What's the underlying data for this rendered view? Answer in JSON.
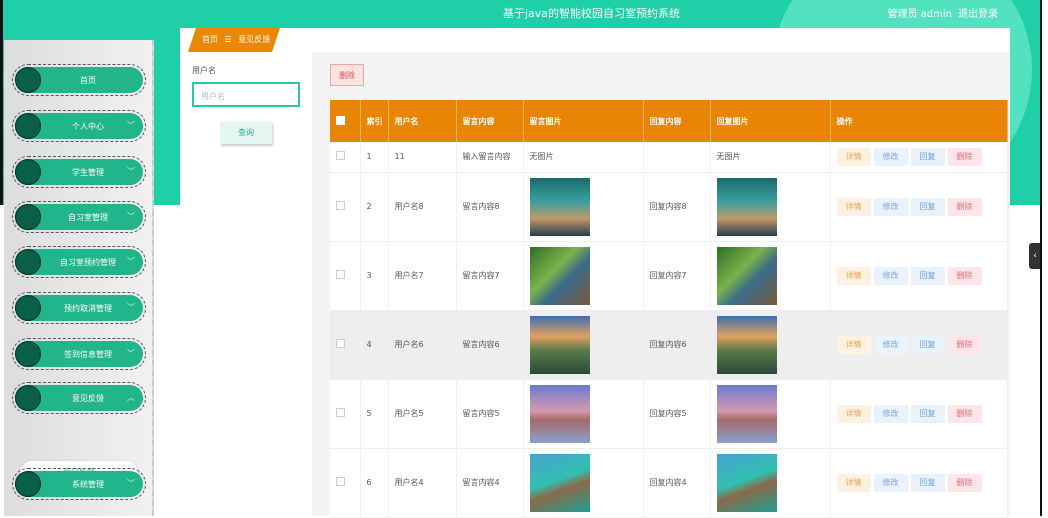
{
  "header": {
    "title": "基于java的智能校园自习室预约系统",
    "user": "管理员 admin",
    "logout": "退出登录"
  },
  "sidebar": {
    "items": [
      {
        "label": "首页",
        "chevron": ""
      },
      {
        "label": "个人中心",
        "chevron": "﹀"
      },
      {
        "label": "学生管理",
        "chevron": "﹀"
      },
      {
        "label": "自习室管理",
        "chevron": "﹀"
      },
      {
        "label": "自习室预约管理",
        "chevron": "﹀"
      },
      {
        "label": "预约取消管理",
        "chevron": "﹀"
      },
      {
        "label": "签到信息管理",
        "chevron": "﹀"
      },
      {
        "label": "意见反馈",
        "chevron": "︿"
      },
      {
        "label": "系统管理",
        "chevron": "﹀"
      }
    ],
    "sub_item": "意见反馈"
  },
  "breadcrumb": {
    "home": "首页",
    "sep": "☰",
    "current": "意见反馈"
  },
  "search": {
    "label": "用户名",
    "placeholder": "用户名",
    "button": "查询"
  },
  "toolbar": {
    "delete": "删除"
  },
  "table": {
    "headers": [
      "索引",
      "用户名",
      "留言内容",
      "留言图片",
      "回复内容",
      "回复图片",
      "操作"
    ],
    "actions": [
      "详情",
      "修改",
      "回复",
      "删除"
    ],
    "rows": [
      {
        "index": "1",
        "user": "11",
        "content": "输入留言内容",
        "image": "无图片",
        "reply": "",
        "reply_image": "无图片"
      },
      {
        "index": "2",
        "user": "用户名8",
        "content": "留言内容8",
        "image": "aurora",
        "reply": "回复内容8",
        "reply_image": "aurora"
      },
      {
        "index": "3",
        "user": "用户名7",
        "content": "留言内容7",
        "image": "forest",
        "reply": "回复内容7",
        "reply_image": "forest"
      },
      {
        "index": "4",
        "user": "用户名6",
        "content": "留言内容6",
        "image": "mountain",
        "reply": "回复内容6",
        "reply_image": "mountain"
      },
      {
        "index": "5",
        "user": "用户名5",
        "content": "留言内容5",
        "image": "lake",
        "reply": "回复内容5",
        "reply_image": "lake"
      },
      {
        "index": "6",
        "user": "用户名4",
        "content": "留言内容4",
        "image": "pier",
        "reply": "回复内容4",
        "reply_image": "pier"
      }
    ]
  },
  "colors": {
    "teal": "#1fcfa7",
    "orange": "#e98404",
    "green": "#22b48a"
  }
}
